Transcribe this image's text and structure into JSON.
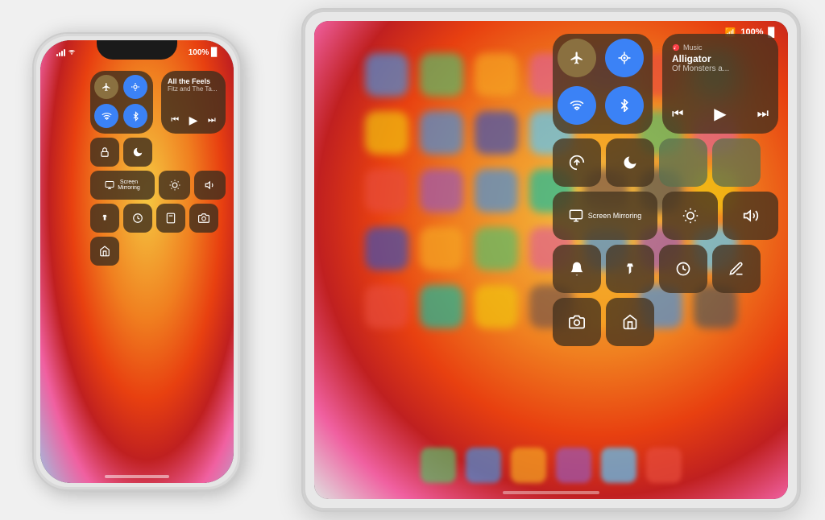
{
  "scene": {
    "bg": "#f2f2f2"
  },
  "ipad": {
    "statusbar": {
      "wifi_label": "wifi",
      "battery_label": "100%",
      "battery_icon": "🔋"
    },
    "control_center": {
      "connectivity": {
        "airplane_active": false,
        "airdrop_active": true,
        "wifi_active": true,
        "bluetooth_active": true
      },
      "now_playing": {
        "title": "Alligator",
        "subtitle": "Of Monsters a...",
        "artist_label": "Of Monsters and Men",
        "song_label": "Alligator"
      },
      "buttons": {
        "lock_rotation": "lock-rotation",
        "do_not_disturb": "moon",
        "screen_mirror_label": "Screen Mirroring",
        "brightness_label": "brightness",
        "volume_label": "volume",
        "notification_label": "bell",
        "flashlight_label": "flashlight",
        "timer_label": "timer",
        "notes_label": "notes",
        "camera_label": "camera",
        "home_label": "home"
      }
    }
  },
  "iphone": {
    "statusbar": {
      "signal_label": "●●●",
      "wifi_label": "wifi",
      "battery_label": "100%"
    },
    "control_center": {
      "connectivity": {
        "airplane_active": true,
        "airdrop_active": true,
        "wifi_active": true,
        "bluetooth_active": true
      },
      "now_playing": {
        "title": "All the Feels",
        "subtitle": "Fitz and The Ta...",
        "artist_label": "Fitz and The Tantrums"
      },
      "screen_mirror_label": "Screen Mirroring"
    }
  }
}
